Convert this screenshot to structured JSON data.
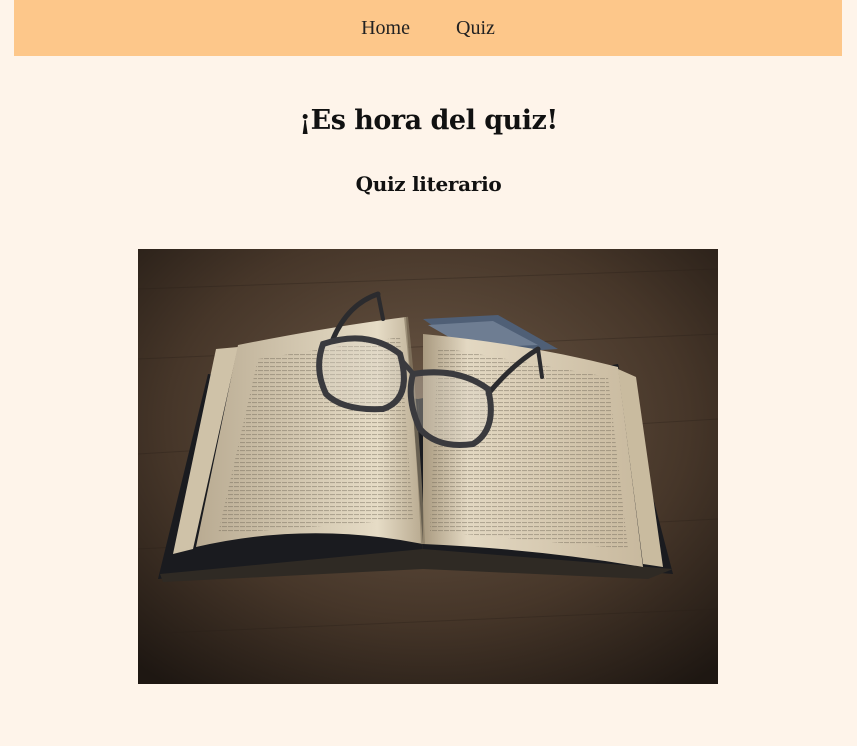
{
  "nav": {
    "items": [
      {
        "label": "Home"
      },
      {
        "label": "Quiz"
      }
    ]
  },
  "main": {
    "title": "¡Es hora del quiz!",
    "subtitle": "Quiz literario",
    "image": {
      "subject": "open book with reading glasses on wooden table"
    }
  },
  "colors": {
    "page_background": "#fef4ea",
    "navbar_background": "#fdc78a",
    "text": "#111111"
  }
}
